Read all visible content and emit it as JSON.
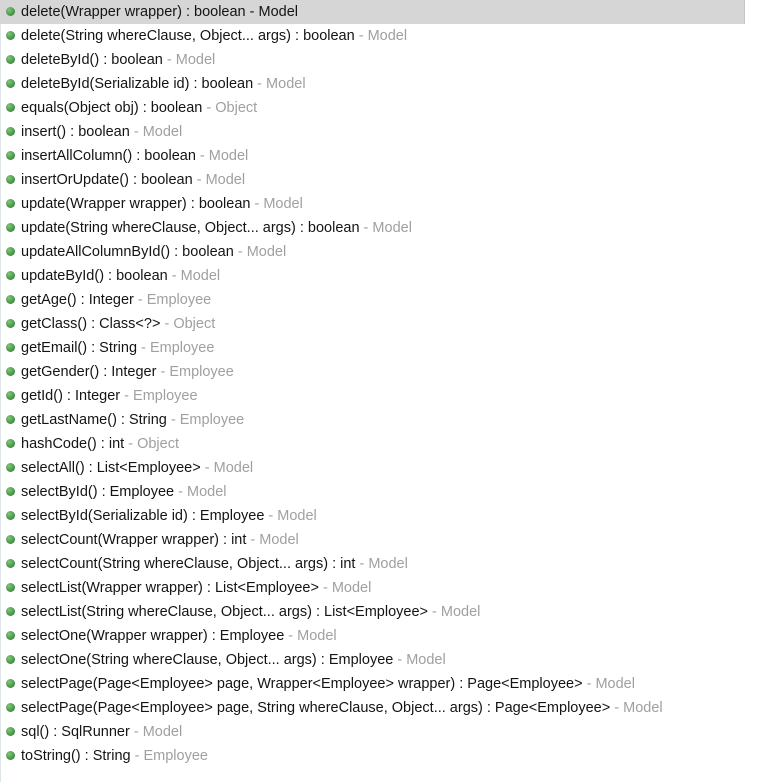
{
  "popup": {
    "kind": "code-completion-proposal-list",
    "icon_name": "public-method-icon",
    "selected_index": 0,
    "colors": {
      "selection_background": "#d6d6d6",
      "method_icon": "#4a9a4a",
      "signature_text": "#141414",
      "owner_text": "#a0a0a0",
      "popup_background": "#ffffff"
    },
    "separator": "-"
  },
  "proposals": [
    {
      "signature": "delete(Wrapper wrapper) : boolean",
      "owner": "Model",
      "selected": true
    },
    {
      "signature": "delete(String whereClause, Object... args) : boolean",
      "owner": "Model",
      "selected": false
    },
    {
      "signature": "deleteById() : boolean",
      "owner": "Model",
      "selected": false
    },
    {
      "signature": "deleteById(Serializable id) : boolean",
      "owner": "Model",
      "selected": false
    },
    {
      "signature": "equals(Object obj) : boolean",
      "owner": "Object",
      "selected": false
    },
    {
      "signature": "insert() : boolean",
      "owner": "Model",
      "selected": false
    },
    {
      "signature": "insertAllColumn() : boolean",
      "owner": "Model",
      "selected": false
    },
    {
      "signature": "insertOrUpdate() : boolean",
      "owner": "Model",
      "selected": false
    },
    {
      "signature": "update(Wrapper wrapper) : boolean",
      "owner": "Model",
      "selected": false
    },
    {
      "signature": "update(String whereClause, Object... args) : boolean",
      "owner": "Model",
      "selected": false
    },
    {
      "signature": "updateAllColumnById() : boolean",
      "owner": "Model",
      "selected": false
    },
    {
      "signature": "updateById() : boolean",
      "owner": "Model",
      "selected": false
    },
    {
      "signature": "getAge() : Integer",
      "owner": "Employee",
      "selected": false
    },
    {
      "signature": "getClass() : Class<?>",
      "owner": "Object",
      "selected": false
    },
    {
      "signature": "getEmail() : String",
      "owner": "Employee",
      "selected": false
    },
    {
      "signature": "getGender() : Integer",
      "owner": "Employee",
      "selected": false
    },
    {
      "signature": "getId() : Integer",
      "owner": "Employee",
      "selected": false
    },
    {
      "signature": "getLastName() : String",
      "owner": "Employee",
      "selected": false
    },
    {
      "signature": "hashCode() : int",
      "owner": "Object",
      "selected": false
    },
    {
      "signature": "selectAll() : List<Employee>",
      "owner": "Model",
      "selected": false
    },
    {
      "signature": "selectById() : Employee",
      "owner": "Model",
      "selected": false
    },
    {
      "signature": "selectById(Serializable id) : Employee",
      "owner": "Model",
      "selected": false
    },
    {
      "signature": "selectCount(Wrapper wrapper) : int",
      "owner": "Model",
      "selected": false
    },
    {
      "signature": "selectCount(String whereClause, Object... args) : int",
      "owner": "Model",
      "selected": false
    },
    {
      "signature": "selectList(Wrapper wrapper) : List<Employee>",
      "owner": "Model",
      "selected": false
    },
    {
      "signature": "selectList(String whereClause, Object... args) : List<Employee>",
      "owner": "Model",
      "selected": false
    },
    {
      "signature": "selectOne(Wrapper wrapper) : Employee",
      "owner": "Model",
      "selected": false
    },
    {
      "signature": "selectOne(String whereClause, Object... args) : Employee",
      "owner": "Model",
      "selected": false
    },
    {
      "signature": "selectPage(Page<Employee> page, Wrapper<Employee> wrapper) : Page<Employee>",
      "owner": "Model",
      "selected": false
    },
    {
      "signature": "selectPage(Page<Employee> page, String whereClause, Object... args) : Page<Employee>",
      "owner": "Model",
      "selected": false
    },
    {
      "signature": "sql() : SqlRunner",
      "owner": "Model",
      "selected": false
    },
    {
      "signature": "toString() : String",
      "owner": "Employee",
      "selected": false
    },
    {
      "signature": "",
      "owner": "",
      "selected": false,
      "clipped": true
    }
  ]
}
